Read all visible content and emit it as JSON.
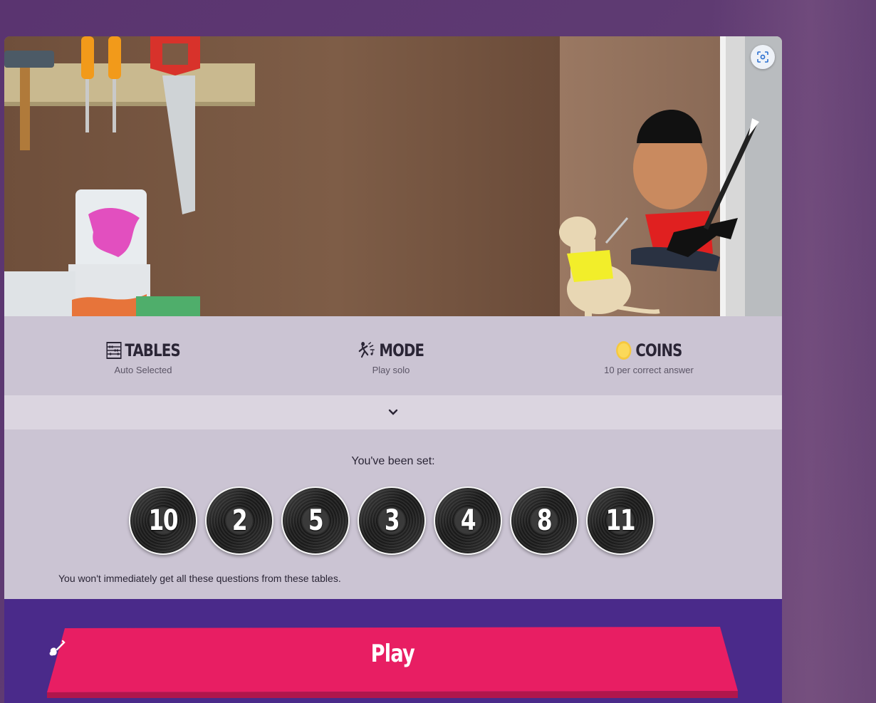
{
  "info": {
    "tables": {
      "title": "TABLES",
      "subtitle": "Auto Selected",
      "icon": "abacus-icon"
    },
    "mode": {
      "title": "MODE",
      "subtitle": "Play solo",
      "icon": "rockstar-icon"
    },
    "coins": {
      "title": "COINS",
      "subtitle": "10 per correct answer",
      "icon": "coin-icon"
    }
  },
  "set": {
    "label": "You've been set:",
    "tables": [
      "10",
      "2",
      "5",
      "3",
      "4",
      "8",
      "11"
    ],
    "note": "You won't immediately get all these questions from these tables."
  },
  "play": {
    "label": "Play",
    "icon": "guitar-icon"
  },
  "colors": {
    "play": "#e81e63",
    "footer": "#4a2a8a",
    "panel": "#cbc4d3",
    "background": "#5a3470"
  }
}
